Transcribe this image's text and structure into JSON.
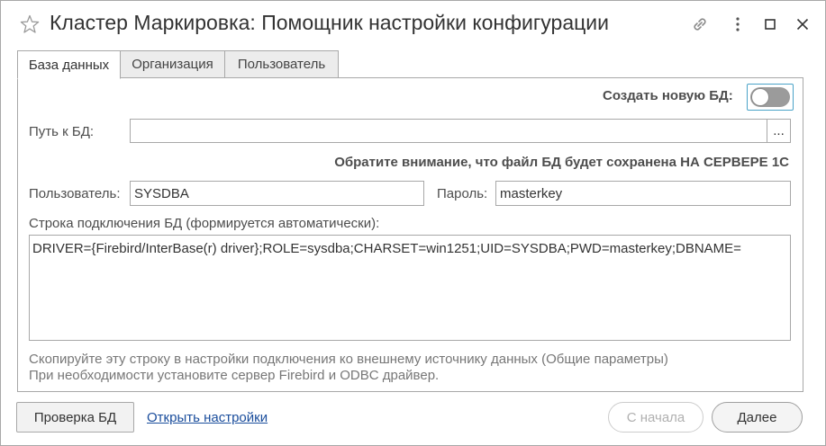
{
  "window": {
    "title": "Кластер Маркировка: Помощник настройки конфигурации"
  },
  "titlebar_icons": [
    "star-icon",
    "link-icon",
    "more-vertical-icon",
    "maximize-icon",
    "close-icon"
  ],
  "tabs": [
    {
      "label": "База данных",
      "active": true
    },
    {
      "label": "Организация",
      "active": false
    },
    {
      "label": "Пользователь",
      "active": false
    }
  ],
  "form": {
    "create_db_label": "Создать новую БД:",
    "create_db_on": false,
    "path_label": "Путь к БД:",
    "path_value": "",
    "path_button": "...",
    "notice": "Обратите внимание, что файл БД будет сохранена НА СЕРВЕРЕ 1С",
    "user_label": "Пользователь:",
    "user_value": "SYSDBA",
    "password_label": "Пароль:",
    "password_value": "masterkey",
    "conn_label": "Строка подключения БД (формируется автоматически):",
    "conn_value": "DRIVER={Firebird/InterBase(r) driver};ROLE=sysdba;CHARSET=win1251;UID=SYSDBA;PWD=masterkey;DBNAME=",
    "hint_line1": "Скопируйте эту строку в настройки подключения ко внешнему источнику данных (Общие параметры)",
    "hint_line2": "При необходимости установите сервер Firebird и ODBC драйвер."
  },
  "footer": {
    "check_button": "Проверка БД",
    "open_settings_link": "Открыть настройки",
    "restart_button": "С начала",
    "next_button": "Далее"
  },
  "colors": {
    "toggle_focus": "#4aa3c8",
    "link": "#1a4d9c",
    "disabled_text": "#b0b0b0"
  }
}
